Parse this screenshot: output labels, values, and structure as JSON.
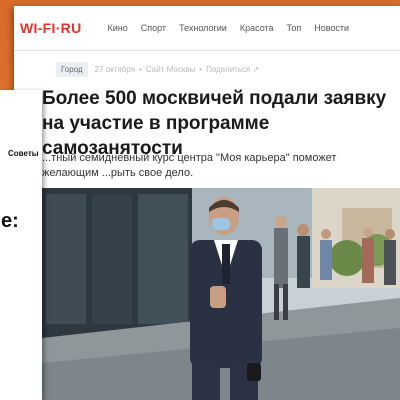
{
  "site": {
    "logo": "WI-FI·RU"
  },
  "nav": {
    "items": [
      "Кино",
      "Спорт",
      "Технологии",
      "Красота",
      "Топ",
      "Новости"
    ]
  },
  "article": {
    "tag": "Город",
    "date": "27 октября",
    "source": "Сайт Москвы",
    "share": "Поделиться ↗",
    "title": "Более 500 москвичей подали заявку на участие в программе самозанятости",
    "lead": "...тный семидневный курс центра \"Моя карьера\" поможет желающим ...рыть свое дело."
  },
  "side_card": {
    "word": "Советы",
    "fragment": "е:"
  },
  "colors": {
    "brand": "#e4312b",
    "background": "#e8732a"
  }
}
